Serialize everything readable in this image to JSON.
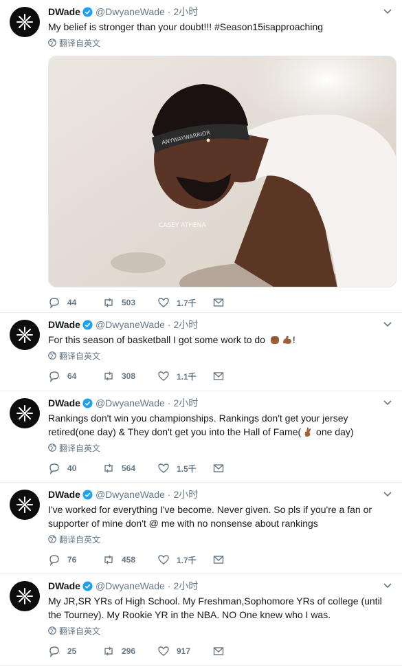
{
  "colors": {
    "text": "#14171a",
    "secondary": "#657786",
    "verified": "#1da1f2",
    "border": "#e6ecf0"
  },
  "tweets": [
    {
      "name": "DWade",
      "handle": "@DwyaneWade",
      "time": "2小时",
      "text": "My belief is stronger than your doubt!!! #Season15isapproaching",
      "translate": "翻译自英文",
      "has_media": true,
      "media_watermark": "CASEY ATHENA",
      "media_headband_text": "ANYWAYWARRIOR",
      "replies": "44",
      "retweets": "503",
      "likes": "1.7千"
    },
    {
      "name": "DWade",
      "handle": "@DwyaneWade",
      "time": "2小时",
      "text": "For this season of basketball I got some work to do",
      "emoji_after": [
        "fist-emoji",
        "flexed-biceps-emoji"
      ],
      "text_tail": "!",
      "translate": "翻译自英文",
      "replies": "64",
      "retweets": "308",
      "likes": "1.1千"
    },
    {
      "name": "DWade",
      "handle": "@DwyaneWade",
      "time": "2小时",
      "text_before": "Rankings don't win you championships. Rankings don't get your jersey retired(one day) & They don't get you into the Hall of Fame(",
      "text_after": " one day)",
      "translate": "翻译自英文",
      "replies": "40",
      "retweets": "564",
      "likes": "1.5千"
    },
    {
      "name": "DWade",
      "handle": "@DwyaneWade",
      "time": "2小时",
      "text": "I've worked for everything I've become. Never given. So pls if you're a fan or supporter of mine don't @ me with no nonsense about rankings",
      "translate": "翻译自英文",
      "replies": "76",
      "retweets": "458",
      "likes": "1.7千"
    },
    {
      "name": "DWade",
      "handle": "@DwyaneWade",
      "time": "2小时",
      "text": "My JR,SR YRs of High School. My Freshman,Sophomore YRs of college (until the Tourney). My Rookie YR in the NBA. NO One knew who I was.",
      "translate": "翻译自英文",
      "replies": "25",
      "retweets": "296",
      "likes": "917"
    }
  ]
}
